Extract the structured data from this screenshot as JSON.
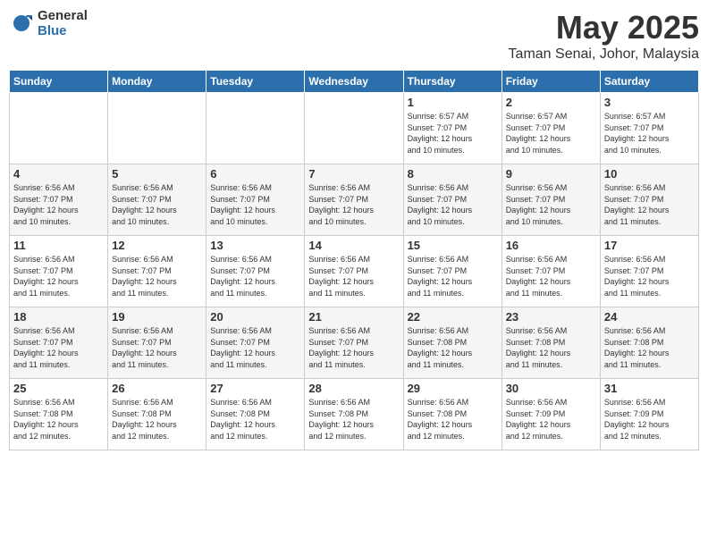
{
  "logo": {
    "general": "General",
    "blue": "Blue"
  },
  "title": "May 2025",
  "location": "Taman Senai, Johor, Malaysia",
  "days_header": [
    "Sunday",
    "Monday",
    "Tuesday",
    "Wednesday",
    "Thursday",
    "Friday",
    "Saturday"
  ],
  "weeks": [
    [
      {
        "day": "",
        "detail": ""
      },
      {
        "day": "",
        "detail": ""
      },
      {
        "day": "",
        "detail": ""
      },
      {
        "day": "",
        "detail": ""
      },
      {
        "day": "1",
        "detail": "Sunrise: 6:57 AM\nSunset: 7:07 PM\nDaylight: 12 hours\nand 10 minutes."
      },
      {
        "day": "2",
        "detail": "Sunrise: 6:57 AM\nSunset: 7:07 PM\nDaylight: 12 hours\nand 10 minutes."
      },
      {
        "day": "3",
        "detail": "Sunrise: 6:57 AM\nSunset: 7:07 PM\nDaylight: 12 hours\nand 10 minutes."
      }
    ],
    [
      {
        "day": "4",
        "detail": "Sunrise: 6:56 AM\nSunset: 7:07 PM\nDaylight: 12 hours\nand 10 minutes."
      },
      {
        "day": "5",
        "detail": "Sunrise: 6:56 AM\nSunset: 7:07 PM\nDaylight: 12 hours\nand 10 minutes."
      },
      {
        "day": "6",
        "detail": "Sunrise: 6:56 AM\nSunset: 7:07 PM\nDaylight: 12 hours\nand 10 minutes."
      },
      {
        "day": "7",
        "detail": "Sunrise: 6:56 AM\nSunset: 7:07 PM\nDaylight: 12 hours\nand 10 minutes."
      },
      {
        "day": "8",
        "detail": "Sunrise: 6:56 AM\nSunset: 7:07 PM\nDaylight: 12 hours\nand 10 minutes."
      },
      {
        "day": "9",
        "detail": "Sunrise: 6:56 AM\nSunset: 7:07 PM\nDaylight: 12 hours\nand 10 minutes."
      },
      {
        "day": "10",
        "detail": "Sunrise: 6:56 AM\nSunset: 7:07 PM\nDaylight: 12 hours\nand 11 minutes."
      }
    ],
    [
      {
        "day": "11",
        "detail": "Sunrise: 6:56 AM\nSunset: 7:07 PM\nDaylight: 12 hours\nand 11 minutes."
      },
      {
        "day": "12",
        "detail": "Sunrise: 6:56 AM\nSunset: 7:07 PM\nDaylight: 12 hours\nand 11 minutes."
      },
      {
        "day": "13",
        "detail": "Sunrise: 6:56 AM\nSunset: 7:07 PM\nDaylight: 12 hours\nand 11 minutes."
      },
      {
        "day": "14",
        "detail": "Sunrise: 6:56 AM\nSunset: 7:07 PM\nDaylight: 12 hours\nand 11 minutes."
      },
      {
        "day": "15",
        "detail": "Sunrise: 6:56 AM\nSunset: 7:07 PM\nDaylight: 12 hours\nand 11 minutes."
      },
      {
        "day": "16",
        "detail": "Sunrise: 6:56 AM\nSunset: 7:07 PM\nDaylight: 12 hours\nand 11 minutes."
      },
      {
        "day": "17",
        "detail": "Sunrise: 6:56 AM\nSunset: 7:07 PM\nDaylight: 12 hours\nand 11 minutes."
      }
    ],
    [
      {
        "day": "18",
        "detail": "Sunrise: 6:56 AM\nSunset: 7:07 PM\nDaylight: 12 hours\nand 11 minutes."
      },
      {
        "day": "19",
        "detail": "Sunrise: 6:56 AM\nSunset: 7:07 PM\nDaylight: 12 hours\nand 11 minutes."
      },
      {
        "day": "20",
        "detail": "Sunrise: 6:56 AM\nSunset: 7:07 PM\nDaylight: 12 hours\nand 11 minutes."
      },
      {
        "day": "21",
        "detail": "Sunrise: 6:56 AM\nSunset: 7:07 PM\nDaylight: 12 hours\nand 11 minutes."
      },
      {
        "day": "22",
        "detail": "Sunrise: 6:56 AM\nSunset: 7:08 PM\nDaylight: 12 hours\nand 11 minutes."
      },
      {
        "day": "23",
        "detail": "Sunrise: 6:56 AM\nSunset: 7:08 PM\nDaylight: 12 hours\nand 11 minutes."
      },
      {
        "day": "24",
        "detail": "Sunrise: 6:56 AM\nSunset: 7:08 PM\nDaylight: 12 hours\nand 11 minutes."
      }
    ],
    [
      {
        "day": "25",
        "detail": "Sunrise: 6:56 AM\nSunset: 7:08 PM\nDaylight: 12 hours\nand 12 minutes."
      },
      {
        "day": "26",
        "detail": "Sunrise: 6:56 AM\nSunset: 7:08 PM\nDaylight: 12 hours\nand 12 minutes."
      },
      {
        "day": "27",
        "detail": "Sunrise: 6:56 AM\nSunset: 7:08 PM\nDaylight: 12 hours\nand 12 minutes."
      },
      {
        "day": "28",
        "detail": "Sunrise: 6:56 AM\nSunset: 7:08 PM\nDaylight: 12 hours\nand 12 minutes."
      },
      {
        "day": "29",
        "detail": "Sunrise: 6:56 AM\nSunset: 7:08 PM\nDaylight: 12 hours\nand 12 minutes."
      },
      {
        "day": "30",
        "detail": "Sunrise: 6:56 AM\nSunset: 7:09 PM\nDaylight: 12 hours\nand 12 minutes."
      },
      {
        "day": "31",
        "detail": "Sunrise: 6:56 AM\nSunset: 7:09 PM\nDaylight: 12 hours\nand 12 minutes."
      }
    ]
  ]
}
